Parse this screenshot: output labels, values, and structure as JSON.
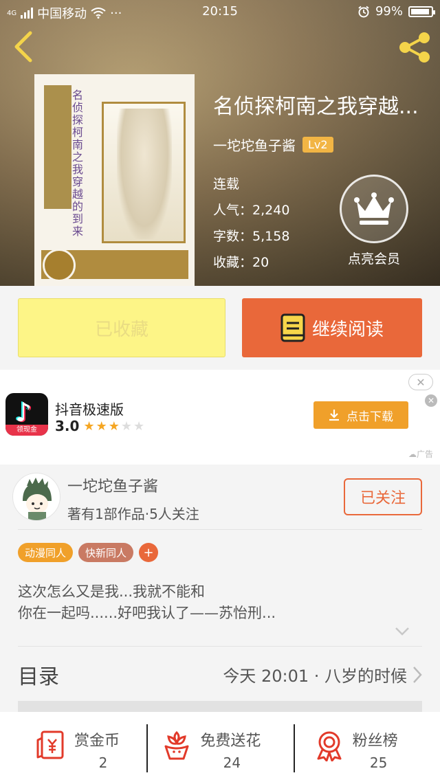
{
  "status_bar": {
    "network": "4G",
    "carrier": "中国移动",
    "more": "···",
    "time": "20:15",
    "battery": "99%"
  },
  "book": {
    "title": "名侦探柯南之我穿越...",
    "cover_title": "名侦探柯南之我穿越的到来",
    "author": "一坨坨鱼子酱",
    "level": "Lv2",
    "status": "连载",
    "popularity_label": "人气：",
    "popularity": "2,240",
    "words_label": "字数：",
    "words": "5,158",
    "favorites_label": "收藏：",
    "favorites": "20"
  },
  "vip": {
    "label": "点亮会员"
  },
  "actions": {
    "collected_label": "已收藏",
    "read_label": "继续阅读"
  },
  "ad": {
    "close": "✕",
    "app_name": "抖音极速版",
    "icon_chip": "领现金",
    "rating": "3.0",
    "stars_filled": 3,
    "stars_total": 5,
    "download_label": "点击下载",
    "tag": "广告"
  },
  "author_card": {
    "name": "一坨坨鱼子酱",
    "stats": "著有1部作品·5人关注",
    "follow_label": "已关注"
  },
  "tags": [
    {
      "label": "动漫同人",
      "color": "#f0a02a"
    },
    {
      "label": "快新同人",
      "color": "#c97a63"
    }
  ],
  "tag_add": "+",
  "synopsis": {
    "line1": "这次怎么又是我...我就不能和",
    "line2": "你在一起吗......好吧我认了——苏怡刑..."
  },
  "catalog": {
    "label": "目录",
    "latest": "今天 20:01 · 八岁的时候"
  },
  "bottom": [
    {
      "label": "赏金币",
      "count": "2"
    },
    {
      "label": "免费送花",
      "count": "24"
    },
    {
      "label": "粉丝榜",
      "count": "25"
    }
  ],
  "colors": {
    "accent": "#e9683a",
    "collected_bg": "#fdf587",
    "level_badge": "#f2b544",
    "download_bg": "#f0a02a"
  }
}
